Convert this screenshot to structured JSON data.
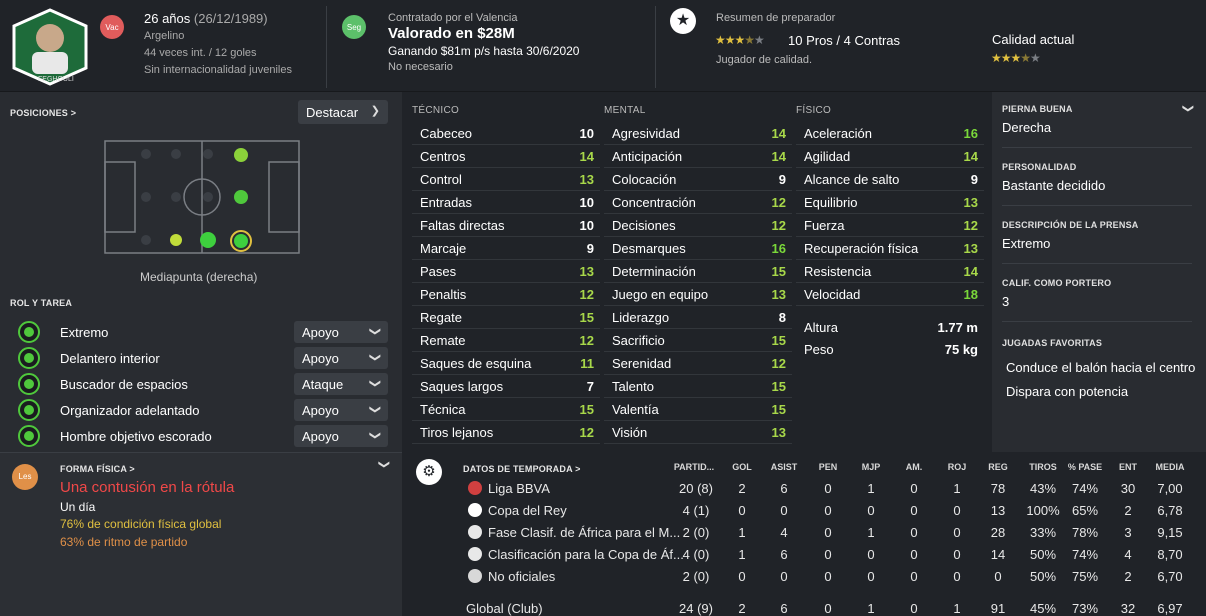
{
  "header": {
    "player_name_label": "FEGHOULI",
    "age": "26 años",
    "birth": "(26/12/1989)",
    "nationality": "Argelino",
    "caps": "44 veces int. / 12 goles",
    "youth": "Sin internacionalidad juveniles",
    "badge_vac": "Vac",
    "badge_seg": "Seg",
    "contract_by": "Contratado por el Valencia",
    "value": "Valorado en $28M",
    "wage": "Ganando $81m p/s hasta 30/6/2020",
    "needed": "No necesario",
    "scout_title": "Resumen de preparador",
    "pros_cons": "10 Pros / 4 Contras",
    "scout_summary": "Jugador de calidad.",
    "current_ability": "Calidad actual",
    "scout_stars": 3.5,
    "ability_stars": 3.5,
    "colors": {
      "vac": "#e05c5c",
      "seg": "#5cc06a",
      "star": "#e0c040"
    }
  },
  "positions": {
    "title": "POSICIONES >",
    "highlight": "Destacar",
    "caption": "Mediapunta (derecha)"
  },
  "roles": {
    "title": "ROL Y TAREA",
    "items": [
      {
        "name": "Extremo",
        "duty": "Apoyo"
      },
      {
        "name": "Delantero interior",
        "duty": "Apoyo"
      },
      {
        "name": "Buscador de espacios",
        "duty": "Ataque"
      },
      {
        "name": "Organizador adelantado",
        "duty": "Apoyo"
      },
      {
        "name": "Hombre objetivo escorado",
        "duty": "Apoyo"
      }
    ]
  },
  "fitness": {
    "title": "FORMA FÍSICA >",
    "badge": "Les",
    "injury": "Una contusión en la rótula",
    "duration": "Un día",
    "condition": "76% de condición física global",
    "sharpness": "63% de ritmo de partido"
  },
  "attributes": {
    "technical": {
      "title": "TÉCNICO",
      "items": [
        {
          "n": "Cabeceo",
          "v": "10"
        },
        {
          "n": "Centros",
          "v": "14"
        },
        {
          "n": "Control",
          "v": "13"
        },
        {
          "n": "Entradas",
          "v": "10"
        },
        {
          "n": "Faltas directas",
          "v": "10"
        },
        {
          "n": "Marcaje",
          "v": "9"
        },
        {
          "n": "Pases",
          "v": "13"
        },
        {
          "n": "Penaltis",
          "v": "12"
        },
        {
          "n": "Regate",
          "v": "15"
        },
        {
          "n": "Remate",
          "v": "12"
        },
        {
          "n": "Saques de esquina",
          "v": "11"
        },
        {
          "n": "Saques largos",
          "v": "7"
        },
        {
          "n": "Técnica",
          "v": "15"
        },
        {
          "n": "Tiros lejanos",
          "v": "12"
        }
      ]
    },
    "mental": {
      "title": "MENTAL",
      "items": [
        {
          "n": "Agresividad",
          "v": "14"
        },
        {
          "n": "Anticipación",
          "v": "14"
        },
        {
          "n": "Colocación",
          "v": "9"
        },
        {
          "n": "Concentración",
          "v": "12"
        },
        {
          "n": "Decisiones",
          "v": "12"
        },
        {
          "n": "Desmarques",
          "v": "16"
        },
        {
          "n": "Determinación",
          "v": "15"
        },
        {
          "n": "Juego en equipo",
          "v": "13"
        },
        {
          "n": "Liderazgo",
          "v": "8"
        },
        {
          "n": "Sacrificio",
          "v": "15"
        },
        {
          "n": "Serenidad",
          "v": "12"
        },
        {
          "n": "Talento",
          "v": "15"
        },
        {
          "n": "Valentía",
          "v": "15"
        },
        {
          "n": "Visión",
          "v": "13"
        }
      ]
    },
    "physical": {
      "title": "FÍSICO",
      "items": [
        {
          "n": "Aceleración",
          "v": "16"
        },
        {
          "n": "Agilidad",
          "v": "14"
        },
        {
          "n": "Alcance de salto",
          "v": "9"
        },
        {
          "n": "Equilibrio",
          "v": "13"
        },
        {
          "n": "Fuerza",
          "v": "12"
        },
        {
          "n": "Recuperación física",
          "v": "13"
        },
        {
          "n": "Resistencia",
          "v": "14"
        },
        {
          "n": "Velocidad",
          "v": "18"
        }
      ]
    },
    "height_label": "Altura",
    "height": "1.77 m",
    "weight_label": "Peso",
    "weight": "75 kg"
  },
  "details": [
    {
      "label": "PIERNA BUENA",
      "value": "Derecha"
    },
    {
      "label": "PERSONALIDAD",
      "value": "Bastante decidido"
    },
    {
      "label": "DESCRIPCIÓN DE LA PRENSA",
      "value": "Extremo"
    },
    {
      "label": "CALIF. COMO PORTERO",
      "value": "3"
    }
  ],
  "moves": {
    "label": "JUGADAS FAVORITAS",
    "items": [
      "Conduce el balón hacia el centro",
      "Dispara con potencia"
    ]
  },
  "season": {
    "title": "DATOS DE TEMPORADA >",
    "headers": [
      "PARTID...",
      "GOL",
      "ASIST",
      "PEN",
      "MJP",
      "AM.",
      "ROJ",
      "REG",
      "TIROS",
      "% PASE",
      "ENT",
      "MEDIA"
    ],
    "rows": [
      {
        "comp": "Liga BBVA",
        "vals": [
          "20 (8)",
          "2",
          "6",
          "0",
          "1",
          "0",
          "1",
          "78",
          "43%",
          "74%",
          "30",
          "7,00"
        ]
      },
      {
        "comp": "Copa del Rey",
        "vals": [
          "4 (1)",
          "0",
          "0",
          "0",
          "0",
          "0",
          "0",
          "13",
          "100%",
          "65%",
          "2",
          "6,78"
        ]
      },
      {
        "comp": "Fase Clasif. de África para el M...",
        "vals": [
          "2 (0)",
          "1",
          "4",
          "0",
          "1",
          "0",
          "0",
          "28",
          "33%",
          "78%",
          "3",
          "9,15"
        ]
      },
      {
        "comp": "Clasificación para la Copa de Áf...",
        "vals": [
          "4 (0)",
          "1",
          "6",
          "0",
          "0",
          "0",
          "0",
          "14",
          "50%",
          "74%",
          "4",
          "8,70"
        ]
      },
      {
        "comp": "No oficiales",
        "vals": [
          "2 (0)",
          "0",
          "0",
          "0",
          "0",
          "0",
          "0",
          "0",
          "50%",
          "75%",
          "2",
          "6,70"
        ]
      }
    ],
    "total": {
      "comp": "Global (Club)",
      "vals": [
        "24 (9)",
        "2",
        "6",
        "0",
        "1",
        "0",
        "1",
        "91",
        "45%",
        "73%",
        "32",
        "6,97"
      ]
    }
  }
}
